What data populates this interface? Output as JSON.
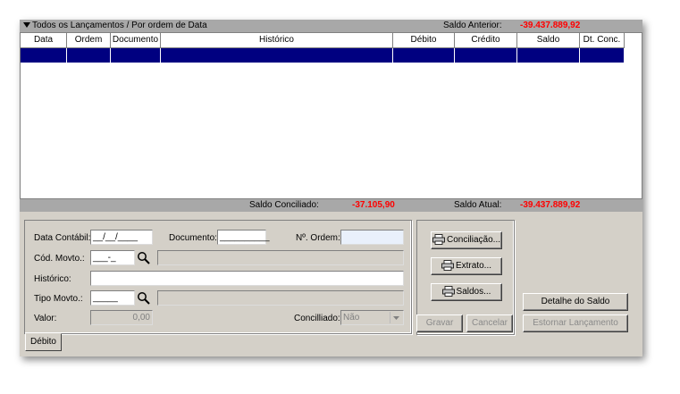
{
  "header": {
    "title": "Todos os Lançamentos / Por ordem de Data",
    "saldo_anterior_label": "Saldo Anterior:",
    "saldo_anterior_value": "-39.437.889,92"
  },
  "grid": {
    "columns": [
      {
        "label": "Data"
      },
      {
        "label": "Ordem"
      },
      {
        "label": "Documento"
      },
      {
        "label": "Histórico"
      },
      {
        "label": "Débito"
      },
      {
        "label": "Crédito"
      },
      {
        "label": "Saldo"
      },
      {
        "label": "Dt. Conc."
      }
    ]
  },
  "summary": {
    "saldo_conciliado_label": "Saldo Conciliado:",
    "saldo_conciliado_value": "-37.105,90",
    "saldo_atual_label": "Saldo Atual:",
    "saldo_atual_value": "-39.437.889,92"
  },
  "form": {
    "data_contabil_label": "Data Contábil:",
    "data_contabil_value": "__/__/____",
    "documento_label": "Documento:",
    "documento_value": "__________",
    "numero_ordem_label": "Nº. Ordem:",
    "numero_ordem_value": "",
    "cod_movto_label": "Cód. Movto.:",
    "cod_movto_value": "___-_",
    "historico_label": "Histórico:",
    "historico_value": "",
    "tipo_movto_label": "Tipo Movto.:",
    "tipo_movto_value": "_____",
    "valor_label": "Valor:",
    "valor_value": "0,00",
    "conciliado_label": "Concilliado:",
    "conciliado_value": "Não"
  },
  "buttons": {
    "conciliacao": "Conciliação...",
    "extrato": "Extrato...",
    "saldos": "Saldos...",
    "detalhe_saldo": "Detalhe do Saldo",
    "gravar": "Gravar",
    "cancelar": "Cancelar",
    "estornar": "Estornar Lançamento"
  },
  "tabs": {
    "debito": "Débito"
  },
  "colors": {
    "selection": "#000080",
    "negative_value": "#ff0000",
    "header_bar": "#a8a8a8"
  }
}
